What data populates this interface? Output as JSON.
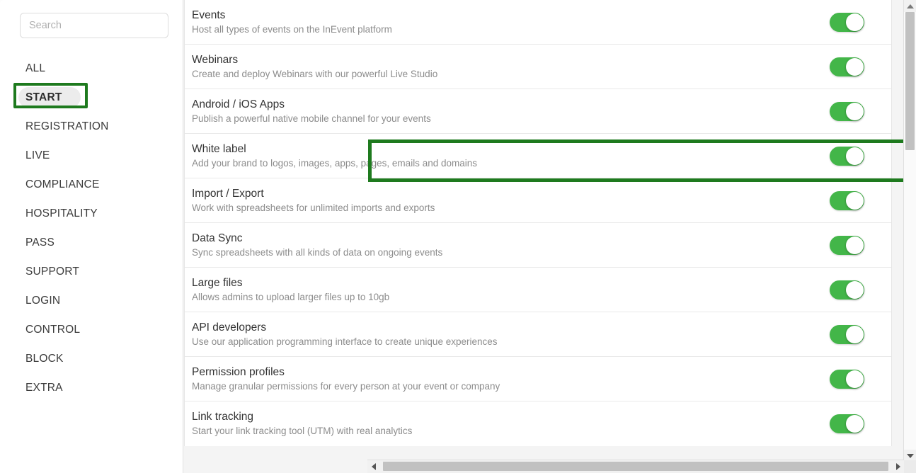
{
  "sidebar": {
    "search": {
      "placeholder": "Search",
      "value": ""
    },
    "items": [
      {
        "label": "ALL",
        "selected": false
      },
      {
        "label": "START",
        "selected": true
      },
      {
        "label": "REGISTRATION",
        "selected": false
      },
      {
        "label": "LIVE",
        "selected": false
      },
      {
        "label": "COMPLIANCE",
        "selected": false
      },
      {
        "label": "HOSPITALITY",
        "selected": false
      },
      {
        "label": "PASS",
        "selected": false
      },
      {
        "label": "SUPPORT",
        "selected": false
      },
      {
        "label": "LOGIN",
        "selected": false
      },
      {
        "label": "CONTROL",
        "selected": false
      },
      {
        "label": "BLOCK",
        "selected": false
      },
      {
        "label": "EXTRA",
        "selected": false
      }
    ]
  },
  "feature_list": {
    "rows": [
      {
        "title": "Events",
        "description": "Host all types of events on the InEvent platform",
        "toggle": "on",
        "highlighted": false
      },
      {
        "title": "Webinars",
        "description": "Create and deploy Webinars with our powerful Live Studio",
        "toggle": "on",
        "highlighted": false
      },
      {
        "title": "Android / iOS Apps",
        "description": "Publish a powerful native mobile channel for your events",
        "toggle": "on",
        "highlighted": false
      },
      {
        "title": "White label",
        "description": "Add your brand to logos, images, apps, pages, emails and domains",
        "toggle": "on",
        "highlighted": true
      },
      {
        "title": "Import / Export",
        "description": "Work with spreadsheets for unlimited imports and exports",
        "toggle": "on",
        "highlighted": false
      },
      {
        "title": "Data Sync",
        "description": "Sync spreadsheets with all kinds of data on ongoing events",
        "toggle": "on",
        "highlighted": false
      },
      {
        "title": "Large files",
        "description": "Allows admins to upload larger files up to 10gb",
        "toggle": "on",
        "highlighted": false
      },
      {
        "title": "API developers",
        "description": "Use our application programming interface to create unique experiences",
        "toggle": "on",
        "highlighted": false
      },
      {
        "title": "Permission profiles",
        "description": "Manage granular permissions for every person at your event or company",
        "toggle": "on",
        "highlighted": false
      },
      {
        "title": "Link tracking",
        "description": "Start your link tracking tool (UTM) with real analytics",
        "toggle": "on",
        "highlighted": false
      }
    ]
  },
  "annotations": {
    "start_highlight_color": "#1e7a1e",
    "row_highlight_color": "#1e7a1e"
  },
  "colors": {
    "toggle_on": "#43b649",
    "title_text": "#333333",
    "desc_text": "#8c8c8c",
    "selected_pill": "#ececec"
  },
  "scrollbars": {
    "vertical": {
      "up_arrow": "▲",
      "down_arrow": "▼"
    },
    "horizontal": {
      "left_arrow": "◀",
      "right_arrow": "▶"
    }
  }
}
